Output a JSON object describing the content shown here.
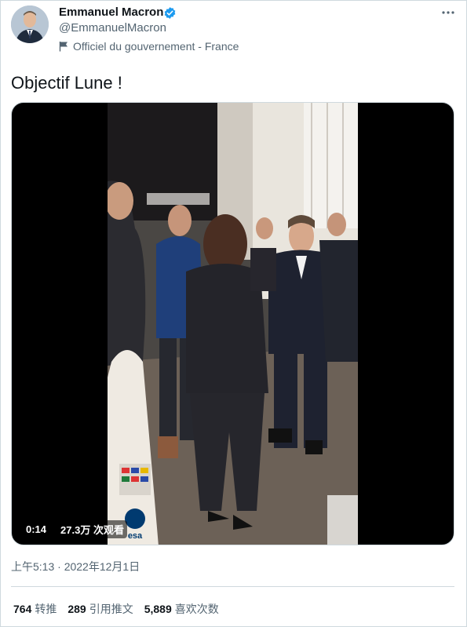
{
  "author": {
    "display_name": "Emmanuel Macron",
    "handle": "@EmmanuelMacron",
    "gov_label": "Officiel du gouvernement - France",
    "verified": true,
    "verified_color": "#1d9bf0"
  },
  "icons": {
    "more": "more-horizontal-icon",
    "verified": "verified-badge-icon",
    "flag": "flag-icon"
  },
  "tweet": {
    "text": "Objectif Lune !"
  },
  "video": {
    "duration": "0:14",
    "views": "27.3万 次观看",
    "rocket_logo": "esa"
  },
  "meta": {
    "timestamp": "上午5:13 · 2022年12月1日"
  },
  "stats": {
    "retweets_value": "764",
    "retweets_label": "转推",
    "quotes_value": "289",
    "quotes_label": "引用推文",
    "likes_value": "5,889",
    "likes_label": "喜欢次数"
  }
}
